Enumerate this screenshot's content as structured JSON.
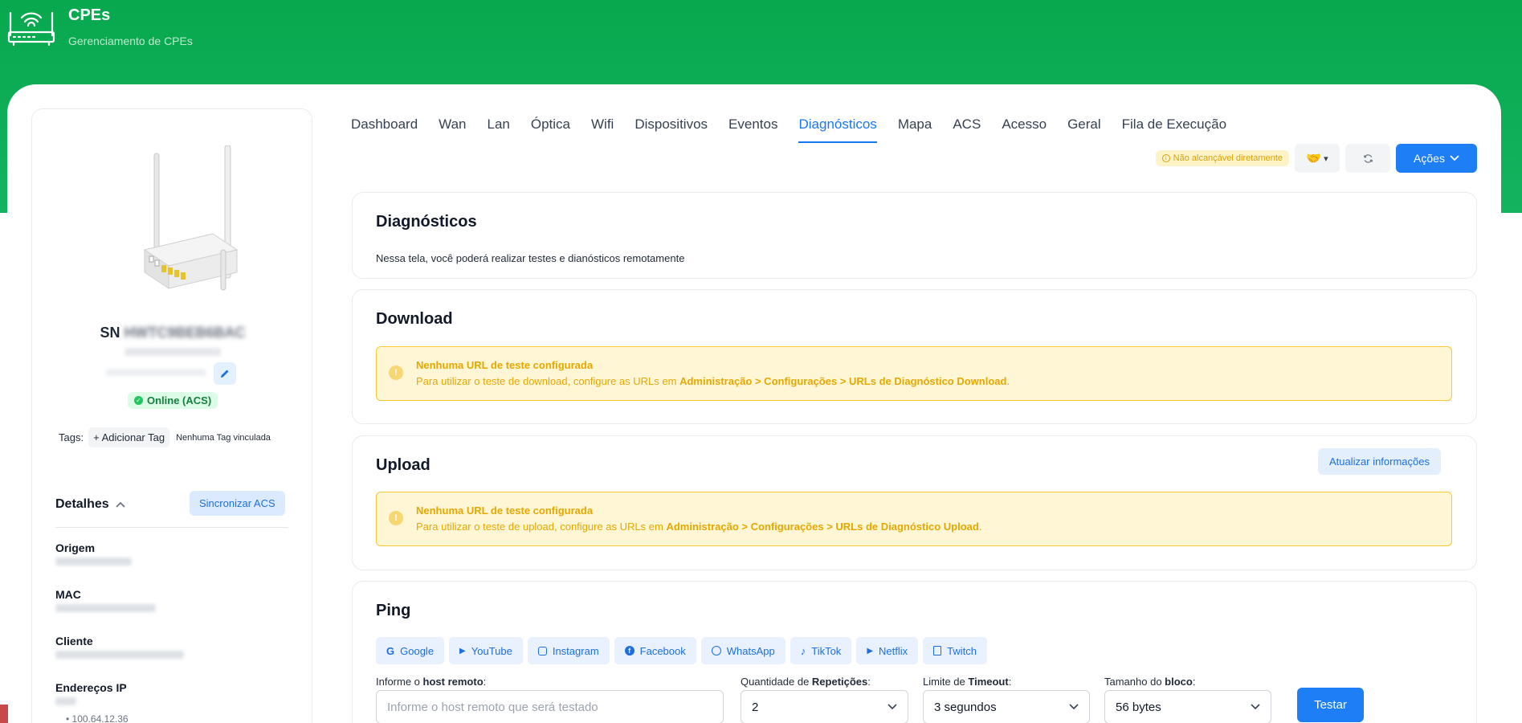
{
  "header": {
    "title": "CPEs",
    "subtitle": "Gerenciamento de CPEs"
  },
  "device": {
    "sn_prefix": "SN",
    "sn_value": "HWTC9BEB6BAC",
    "status": "Online (ACS)",
    "tags_label": "Tags:",
    "add_tag": "+ Adicionar Tag",
    "no_tag": "Nenhuma Tag vinculada"
  },
  "details": {
    "title": "Detalhes",
    "sync_button": "Sincronizar ACS",
    "origem_label": "Origem",
    "mac_label": "MAC",
    "cliente_label": "Cliente",
    "ip_label": "Endereços IP",
    "ip_item": "• 100.64.12.36"
  },
  "tabs": [
    "Dashboard",
    "Wan",
    "Lan",
    "Óptica",
    "Wifi",
    "Dispositivos",
    "Eventos",
    "Diagnósticos",
    "Mapa",
    "ACS",
    "Acesso",
    "Geral",
    "Fila de Execução"
  ],
  "toolbar": {
    "reachability": "Não alcançável diretamente",
    "actions": "Ações"
  },
  "diagnostics": {
    "title": "Diagnósticos",
    "description": "Nessa tela, você poderá realizar testes e dianósticos remotamente"
  },
  "download": {
    "title": "Download",
    "alert_title": "Nenhuma URL de teste configurada",
    "alert_text": "Para utilizar o teste de download, configure as URLs em ",
    "alert_path": "Administração > Configurações > URLs de Diagnóstico Download",
    "alert_end": "."
  },
  "upload": {
    "title": "Upload",
    "update_button": "Atualizar informações",
    "alert_title": "Nenhuma URL de teste configurada",
    "alert_text": "Para utilizar o teste de upload, configure as URLs em ",
    "alert_path": "Administração > Configurações > URLs de Diagnóstico Upload",
    "alert_end": "."
  },
  "ping": {
    "title": "Ping",
    "presets": [
      "Google",
      "YouTube",
      "Instagram",
      "Facebook",
      "WhatsApp",
      "TikTok",
      "Netflix",
      "Twitch"
    ],
    "host_label_pre": "Informe o ",
    "host_label_bold": "host remoto",
    "host_label_post": ":",
    "host_placeholder": "Informe o host remoto que será testado",
    "reps_label_pre": "Quantidade de ",
    "reps_label_bold": "Repetições",
    "reps_value": "2",
    "timeout_label_pre": "Limite de ",
    "timeout_label_bold": "Timeout",
    "timeout_value": "3 segundos",
    "block_label_pre": "Tamanho do ",
    "block_label_bold": "bloco",
    "block_value": "56 bytes",
    "colon": ":",
    "test_button": "Testar"
  }
}
